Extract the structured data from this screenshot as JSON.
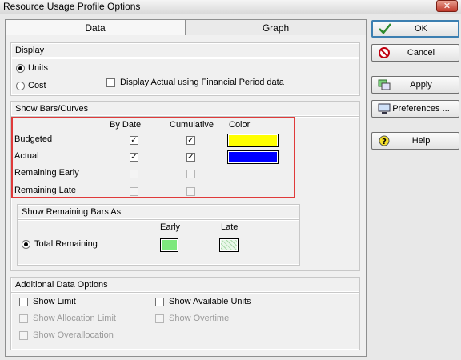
{
  "window": {
    "title": "Resource Usage Profile Options"
  },
  "tabs": [
    {
      "label": "Data"
    },
    {
      "label": "Graph"
    }
  ],
  "display": {
    "header": "Display",
    "units_label": "Units",
    "cost_label": "Cost",
    "selected": "Units",
    "financial_label": "Display Actual using Financial Period data",
    "financial_checked": false
  },
  "show_bars": {
    "header": "Show Bars/Curves",
    "col_by_date": "By Date",
    "col_cumulative": "Cumulative",
    "col_color": "Color",
    "rows": [
      {
        "label": "Budgeted",
        "by_date": true,
        "cumulative": true,
        "color": "#ffff00"
      },
      {
        "label": "Actual",
        "by_date": true,
        "cumulative": true,
        "color": "#0000ff"
      },
      {
        "label": "Remaining Early",
        "by_date": false,
        "cumulative": false
      },
      {
        "label": "Remaining Late",
        "by_date": false,
        "cumulative": false
      }
    ]
  },
  "remaining": {
    "header": "Show Remaining Bars As",
    "early_label": "Early",
    "late_label": "Late",
    "option_label": "Total Remaining",
    "early_color": "#7ee87e",
    "late_color": "#e8f7e8"
  },
  "additional": {
    "header": "Additional Data Options",
    "show_limit": "Show Limit",
    "show_available_units": "Show Available Units",
    "show_allocation_limit": "Show Allocation Limit",
    "show_overtime": "Show Overtime",
    "show_overallocation": "Show Overallocation"
  },
  "buttons": {
    "ok": "OK",
    "cancel": "Cancel",
    "apply": "Apply",
    "preferences": "Preferences ...",
    "help": "Help"
  }
}
